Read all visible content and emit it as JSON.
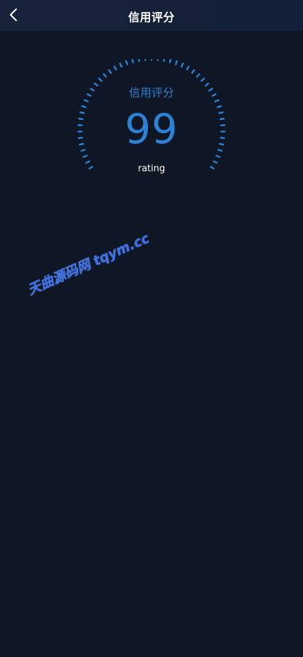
{
  "header": {
    "title": "信用评分",
    "back_icon": "chevron-left-icon"
  },
  "gauge": {
    "label": "信用评分",
    "value": "99",
    "caption": "rating",
    "accent_color": "#2c83d6"
  },
  "watermark": {
    "text": "天曲源码网 tqym.cc",
    "color": "#3f79ff"
  },
  "theme": {
    "background": "#0f1727",
    "header_background": "#142139"
  }
}
